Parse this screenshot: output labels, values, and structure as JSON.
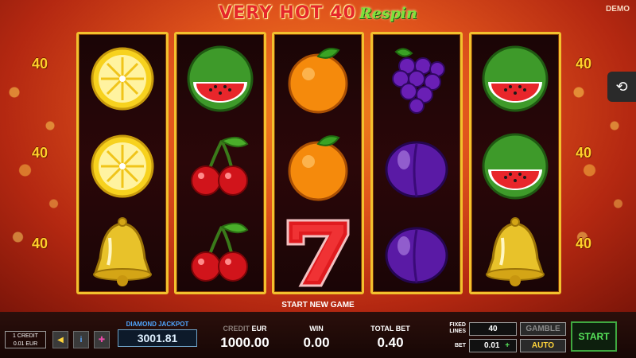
{
  "game": {
    "title_main": "VERY HOT 40",
    "title_sub": "Respin",
    "mode_badge": "DEMO",
    "line_count_label": "40"
  },
  "reels": [
    [
      "lemon-icon",
      "lemon-icon",
      "bell-icon"
    ],
    [
      "watermelon-icon",
      "cherries-icon",
      "cherries-icon"
    ],
    [
      "orange-icon",
      "orange-icon",
      "seven-icon"
    ],
    [
      "grapes-icon",
      "plum-icon",
      "plum-icon"
    ],
    [
      "watermelon-icon",
      "watermelon-icon",
      "bell-icon"
    ]
  ],
  "status_message": "START NEW GAME",
  "bottom_bar": {
    "credit_box_line1": "1 CREDIT",
    "credit_box_line2": "0.01 EUR",
    "jackpot_label": "DIAMOND JACKPOT",
    "jackpot_value": "3001.81",
    "credit_label_dim": "CREDIT",
    "credit_label_currency": "EUR",
    "credit_value": "1000.00",
    "win_label": "WIN",
    "win_value": "0.00",
    "total_bet_label": "TOTAL BET",
    "total_bet_value": "0.40",
    "fixed_lines_label": "FIXED LINES",
    "fixed_lines_value": "40",
    "bet_label": "BET",
    "bet_value": "0.01",
    "gamble_label": "GAMBLE",
    "auto_label": "AUTO",
    "start_label": "START"
  },
  "colors": {
    "frame_gold": "#f2c12e",
    "title_red": "#e5262b",
    "title_green": "#7ee23b",
    "start_green": "#56e45a",
    "jackpot_blue": "#4fa6ff"
  }
}
